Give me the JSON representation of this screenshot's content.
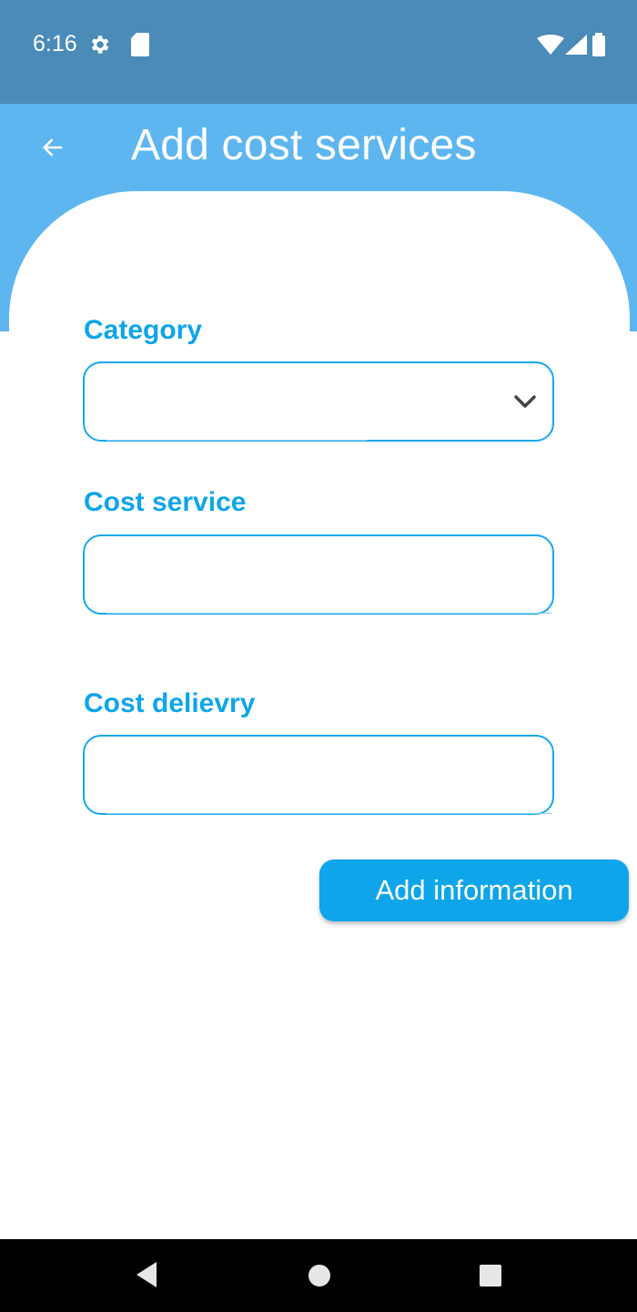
{
  "status_bar": {
    "time": "6:16",
    "icons": [
      "gear-icon",
      "sd-card-icon",
      "wifi-icon",
      "signal-icon",
      "battery-icon"
    ]
  },
  "header": {
    "title": "Add cost services",
    "back_icon": "arrow-left-icon"
  },
  "form": {
    "category": {
      "label": "Category",
      "value": "",
      "icon": "chevron-down-icon"
    },
    "cost_service": {
      "label": "Cost service",
      "value": ""
    },
    "cost_delivery": {
      "label": "Cost delievry",
      "value": ""
    },
    "submit_label": "Add information"
  },
  "nav": {
    "icons": [
      "nav-back-icon",
      "nav-home-icon",
      "nav-recents-icon"
    ]
  },
  "colors": {
    "status_bar": "#4a8bb8",
    "header": "#5db6ef",
    "accent": "#0ea5ea",
    "nav_bar": "#000000"
  }
}
